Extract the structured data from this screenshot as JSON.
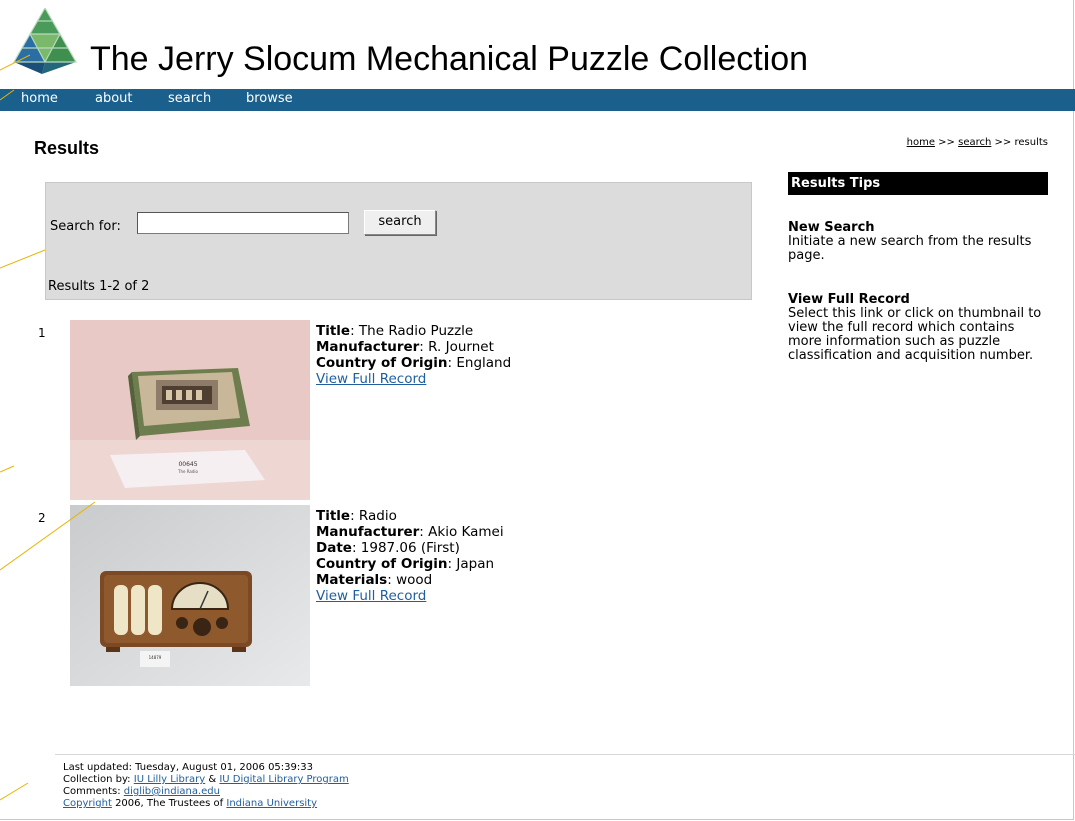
{
  "site": {
    "title": "The Jerry Slocum Mechanical Puzzle Collection"
  },
  "nav": {
    "items": [
      "home",
      "about",
      "search",
      "browse"
    ]
  },
  "page": {
    "heading": "Results"
  },
  "breadcrumb": {
    "home": "home",
    "sep1": ">>",
    "search": "search",
    "sep2": ">>",
    "current": "results"
  },
  "search": {
    "label": "Search for:",
    "value": "",
    "button": "search",
    "results_count": "Results 1-2 of 2"
  },
  "results": [
    {
      "num": "1",
      "fields": [
        {
          "label": "Title",
          "value": "The Radio Puzzle"
        },
        {
          "label": "Manufacturer",
          "value": "R. Journet"
        },
        {
          "label": "Country of Origin",
          "value": "England"
        }
      ],
      "link": "View Full Record"
    },
    {
      "num": "2",
      "fields": [
        {
          "label": "Title",
          "value": "Radio"
        },
        {
          "label": "Manufacturer",
          "value": "Akio Kamei"
        },
        {
          "label": "Date",
          "value": "1987.06 (First)"
        },
        {
          "label": "Country of Origin",
          "value": "Japan"
        },
        {
          "label": "Materials",
          "value": "wood"
        }
      ],
      "link": "View Full Record"
    }
  ],
  "tips": {
    "title": "Results Tips",
    "items": [
      {
        "heading": "New Search",
        "text": "Initiate a new search from the results page."
      },
      {
        "heading": "View Full Record",
        "text": "Select this link or click on thumbnail to view the full record which contains more information such as puzzle classification and acquisition number."
      }
    ]
  },
  "footer": {
    "updated": "Last updated: Tuesday, August 01, 2006 05:39:33",
    "collection_prefix": "Collection by:",
    "lilly": "IU Lilly Library",
    "amp": "&",
    "dlp": "IU Digital Library Program",
    "comments_prefix": "Comments:",
    "email": "diglib@indiana.edu",
    "copyright": "Copyright",
    "copyright_text": "2006, The Trustees of",
    "iu": "Indiana University"
  },
  "colors": {
    "nav_bg": "#1b5f8c",
    "link": "#1f5fa0",
    "search_bg": "#dcdcdc",
    "annotation": "#e8b400"
  }
}
